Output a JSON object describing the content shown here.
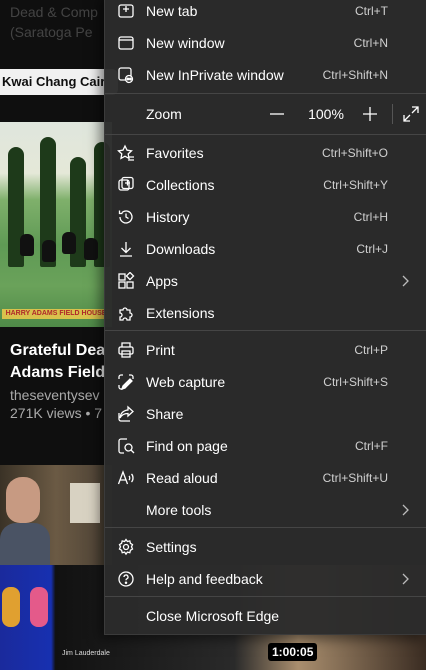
{
  "background": {
    "top_title": "Dead & Comp\n(Saratoga Pe",
    "chip_label": "Kwai Chang Cair",
    "video1": {
      "thumb_banner": "HARRY ADAMS FIELD HOUSE",
      "title": "Grateful Dea\nAdams Field",
      "channel": "theseventysev",
      "meta": "271K views • 7"
    },
    "video3": {
      "caption": "Jim Lauderdale",
      "duration": "1:00:05"
    }
  },
  "menu": {
    "items": [
      {
        "id": "new-tab",
        "label": "New tab",
        "shortcut": "Ctrl+T",
        "icon": "new-tab-icon"
      },
      {
        "id": "new-window",
        "label": "New window",
        "shortcut": "Ctrl+N",
        "icon": "new-window-icon"
      },
      {
        "id": "new-inprivate-window",
        "label": "New InPrivate window",
        "shortcut": "Ctrl+Shift+N",
        "icon": "inprivate-icon"
      },
      {
        "id": "favorites",
        "label": "Favorites",
        "shortcut": "Ctrl+Shift+O",
        "icon": "favorites-icon"
      },
      {
        "id": "collections",
        "label": "Collections",
        "shortcut": "Ctrl+Shift+Y",
        "icon": "collections-icon"
      },
      {
        "id": "history",
        "label": "History",
        "shortcut": "Ctrl+H",
        "icon": "history-icon"
      },
      {
        "id": "downloads",
        "label": "Downloads",
        "shortcut": "Ctrl+J",
        "icon": "download-icon"
      },
      {
        "id": "apps",
        "label": "Apps",
        "shortcut": "",
        "icon": "apps-icon"
      },
      {
        "id": "extensions",
        "label": "Extensions",
        "shortcut": "",
        "icon": "extensions-icon"
      },
      {
        "id": "print",
        "label": "Print",
        "shortcut": "Ctrl+P",
        "icon": "print-icon"
      },
      {
        "id": "web-capture",
        "label": "Web capture",
        "shortcut": "Ctrl+Shift+S",
        "icon": "web-capture-icon"
      },
      {
        "id": "share",
        "label": "Share",
        "shortcut": "",
        "icon": "share-icon"
      },
      {
        "id": "find-on-page",
        "label": "Find on page",
        "shortcut": "Ctrl+F",
        "icon": "find-icon"
      },
      {
        "id": "read-aloud",
        "label": "Read aloud",
        "shortcut": "Ctrl+Shift+U",
        "icon": "read-aloud-icon"
      },
      {
        "id": "more-tools",
        "label": "More tools",
        "shortcut": "",
        "icon": "more-tools-icon"
      },
      {
        "id": "settings",
        "label": "Settings",
        "shortcut": "",
        "icon": "settings-icon"
      },
      {
        "id": "help-feedback",
        "label": "Help and feedback",
        "shortcut": "",
        "icon": "help-icon"
      },
      {
        "id": "close-edge",
        "label": "Close Microsoft Edge",
        "shortcut": "",
        "icon": ""
      }
    ],
    "zoom": {
      "label": "Zoom",
      "value": "100%"
    }
  }
}
